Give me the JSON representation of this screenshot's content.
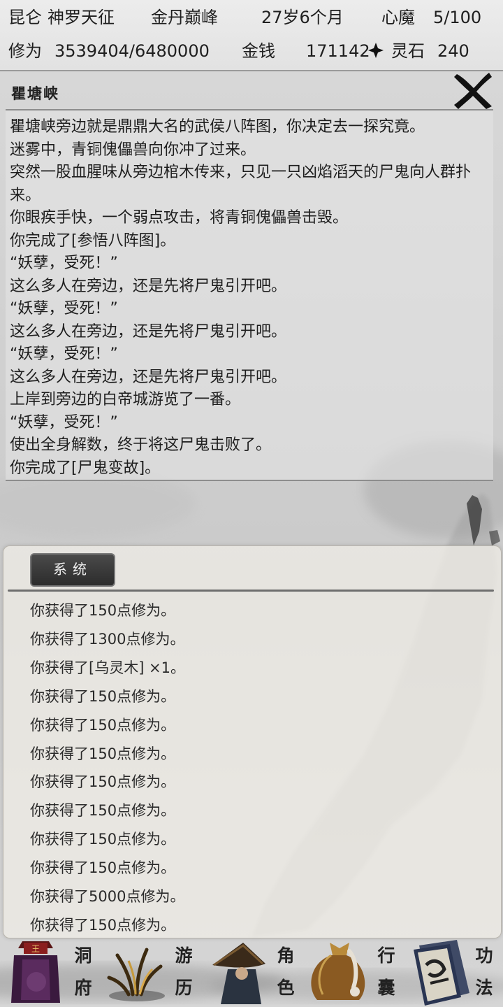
{
  "status": {
    "sect": "昆仑",
    "title": "神罗天征",
    "realm": "金丹巅峰",
    "age": "27岁6个月",
    "demon_label": "心魔",
    "demon_value": "5/100",
    "cultivation_label": "修为",
    "cultivation_value": "3539404/6480000",
    "money_label": "金钱",
    "money_value": "171142",
    "spirit_stone_label": "灵石",
    "spirit_stone_value": "240"
  },
  "event": {
    "title": "瞿塘峡",
    "close_icon": "close-icon",
    "lines": [
      "瞿塘峡旁边就是鼎鼎大名的武侯八阵图，你决定去一探究竟。",
      "迷雾中，青铜傀儡兽向你冲了过来。",
      "突然一股血腥味从旁边棺木传来，只见一只凶焰滔天的尸鬼向人群扑来。",
      "你眼疾手快，一个弱点攻击，将青铜傀儡兽击毁。",
      "你完成了[参悟八阵图]。",
      "“妖孽，受死！”",
      "这么多人在旁边，还是先将尸鬼引开吧。",
      "“妖孽，受死！”",
      "这么多人在旁边，还是先将尸鬼引开吧。",
      "“妖孽，受死！”",
      "这么多人在旁边，还是先将尸鬼引开吧。",
      "上岸到旁边的白帝城游览了一番。",
      "“妖孽，受死！”",
      "使出全身解数，终于将这尸鬼击败了。",
      "你完成了[尸鬼变故]。"
    ]
  },
  "system": {
    "tab_label": "系统",
    "messages": [
      "你获得了150点修为。",
      "你获得了1300点修为。",
      "你获得了[乌灵木] ×1。",
      "你获得了150点修为。",
      "你获得了150点修为。",
      "你获得了150点修为。",
      "你获得了150点修为。",
      "你获得了150点修为。",
      "你获得了150点修为。",
      "你获得了150点修为。",
      "你获得了5000点修为。",
      "你获得了150点修为。"
    ]
  },
  "nav": {
    "cave": {
      "top": "洞",
      "bottom": "府",
      "icon": "cave-icon"
    },
    "travel": {
      "top": "游",
      "bottom": "历",
      "icon": "travel-icon"
    },
    "character": {
      "top": "角",
      "bottom": "色",
      "icon": "character-icon"
    },
    "bag": {
      "top": "行",
      "bottom": "囊",
      "icon": "bag-icon"
    },
    "skills": {
      "top": "功",
      "bottom": "法",
      "icon": "skills-icon"
    }
  },
  "colors": {
    "panel_border": "#8d8d8d",
    "tab_bg": "#2c2c2c",
    "text": "#1f1f1f"
  }
}
